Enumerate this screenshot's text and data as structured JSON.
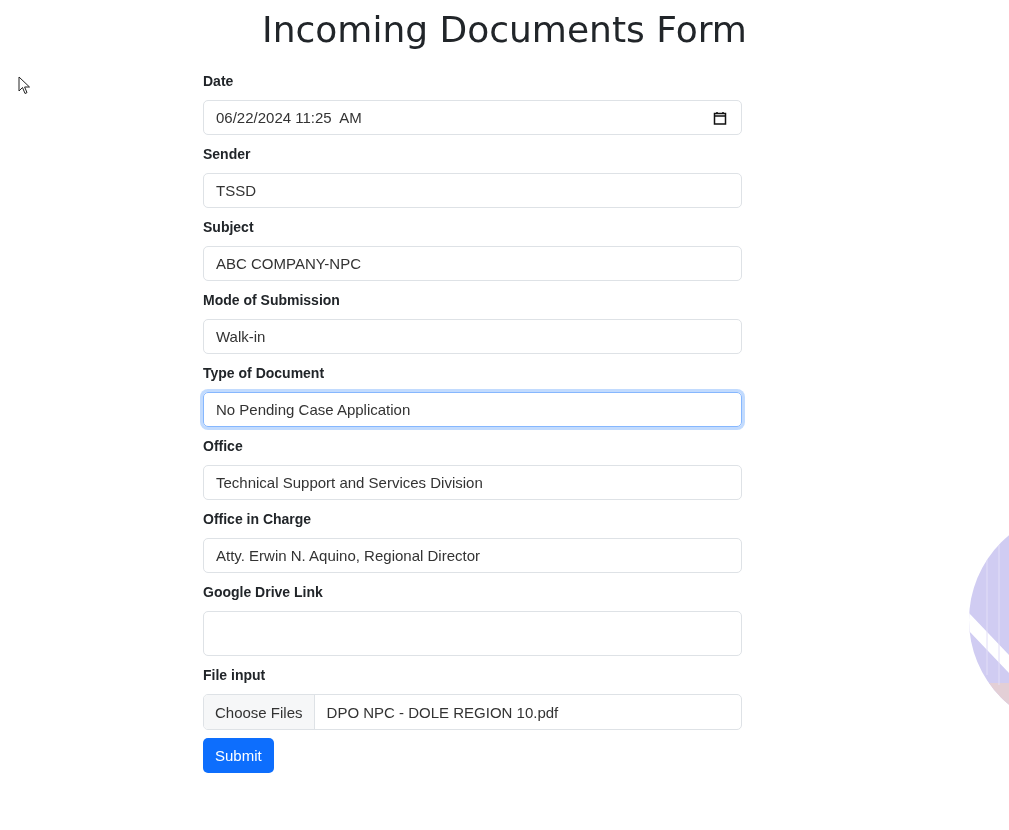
{
  "title": "Incoming Documents Form",
  "fields": [
    {
      "label": "Date",
      "kind": "datetime",
      "value": "06/22/2024 11:25  AM",
      "focused": false
    },
    {
      "label": "Sender",
      "kind": "text",
      "value": "TSSD",
      "focused": false
    },
    {
      "label": "Subject",
      "kind": "text",
      "value": "ABC COMPANY-NPC",
      "focused": false
    },
    {
      "label": "Mode of Submission",
      "kind": "text",
      "value": "Walk-in",
      "focused": false
    },
    {
      "label": "Type of Document",
      "kind": "text",
      "value": "No Pending Case Application",
      "focused": true
    },
    {
      "label": "Office",
      "kind": "text",
      "value": "Technical Support and Services Division",
      "focused": false
    },
    {
      "label": "Office in Charge",
      "kind": "text",
      "value": "Atty. Erwin N. Aquino, Regional Director",
      "focused": false
    },
    {
      "label": "Google Drive Link",
      "kind": "textarea",
      "focused": false
    },
    {
      "label": "File input",
      "kind": "file",
      "button": "Choose Files",
      "value": "DPO NPC - DOLE REGION 10.pdf",
      "focused": false
    }
  ],
  "submit": "Submit"
}
